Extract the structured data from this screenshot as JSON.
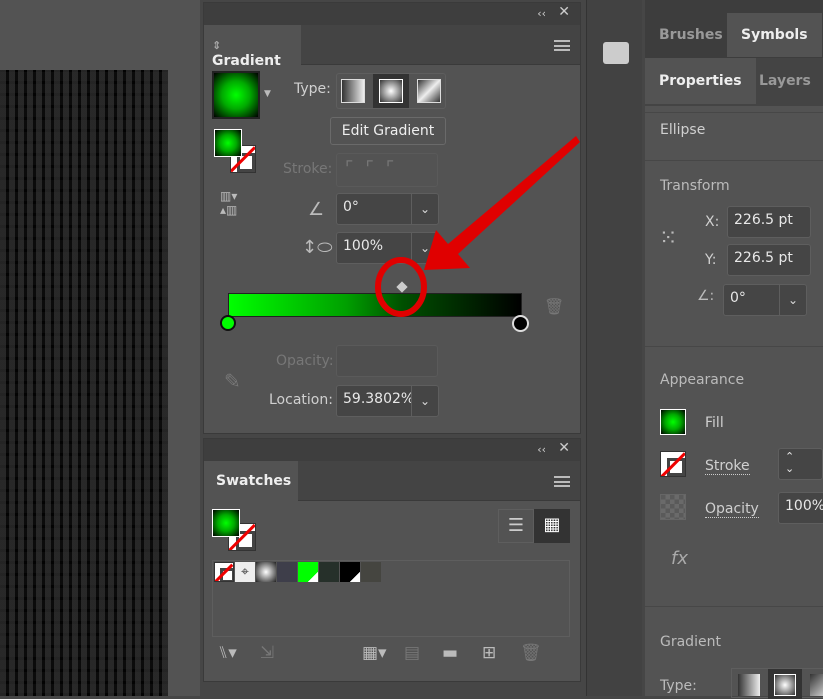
{
  "gradient_panel": {
    "title": "Gradient",
    "type_label": "Type:",
    "types": [
      "linear",
      "radial",
      "freeform"
    ],
    "selected_type": "radial",
    "edit_button": "Edit Gradient",
    "stroke_label": "Stroke:",
    "angle_value": "0°",
    "aspect_value": "100%",
    "opacity_label": "Opacity:",
    "opacity_value": "",
    "location_label": "Location:",
    "location_value": "59.3802%",
    "stops": [
      {
        "color": "#00ff00",
        "location": 0
      },
      {
        "color": "#000000",
        "location": 100
      }
    ],
    "midpoint_location": 59.3802
  },
  "swatches_panel": {
    "title": "Swatches",
    "swatches": [
      {
        "name": "none"
      },
      {
        "name": "registration"
      },
      {
        "name": "radial-gradient"
      },
      {
        "color": "#3e3e4a"
      },
      {
        "color": "#00ff00"
      },
      {
        "color": "#26302a"
      },
      {
        "color": "#000000"
      },
      {
        "color": "#454540"
      }
    ]
  },
  "right_panel": {
    "tabs_top": [
      "Brushes",
      "Symbols"
    ],
    "tabs": [
      "Properties",
      "Layers"
    ],
    "object_type": "Ellipse",
    "transform": {
      "title": "Transform",
      "x_label": "X:",
      "x_value": "226.5 pt",
      "y_label": "Y:",
      "y_value": "226.5 pt",
      "angle_value": "0°"
    },
    "appearance": {
      "title": "Appearance",
      "fill": "Fill",
      "stroke": "Stroke",
      "opacity": "Opacity",
      "opacity_value": "100%",
      "fx": "fx"
    },
    "gradient": {
      "title": "Gradient",
      "type_label": "Type:"
    }
  },
  "annotation": {
    "color": "#e00000"
  }
}
